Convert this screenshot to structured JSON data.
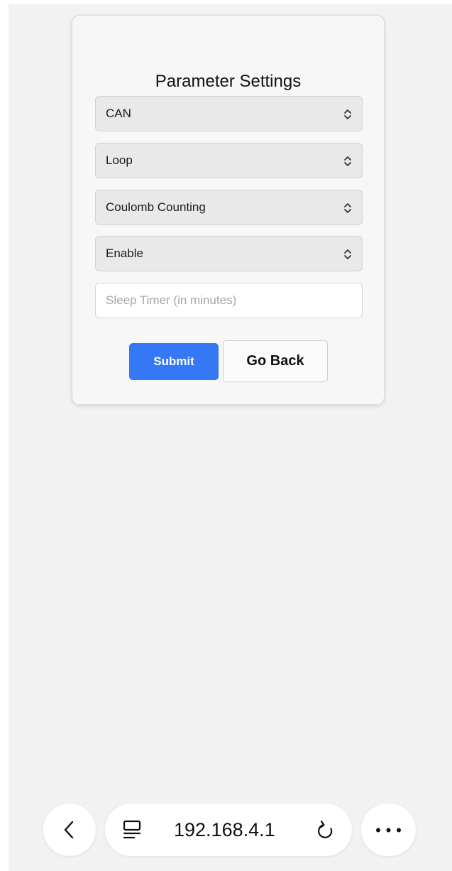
{
  "form": {
    "title": "Parameter Settings",
    "selects": [
      {
        "value": "CAN"
      },
      {
        "value": "Loop"
      },
      {
        "value": "Coulomb Counting"
      },
      {
        "value": "Enable"
      }
    ],
    "sleep_timer": {
      "value": "",
      "placeholder": "Sleep Timer (in minutes)"
    },
    "submit_label": "Submit",
    "go_back_label": "Go Back"
  },
  "browser": {
    "url": "192.168.4.1",
    "icons": {
      "back": "chevron-left-icon",
      "page_menu": "page-menu-icon",
      "reload": "reload-icon",
      "more": "more-icon"
    }
  },
  "colors": {
    "accent": "#3478f6",
    "background": "#f2f2f2",
    "card": "#f7f7f7",
    "select_bg": "#e9e9e9"
  }
}
